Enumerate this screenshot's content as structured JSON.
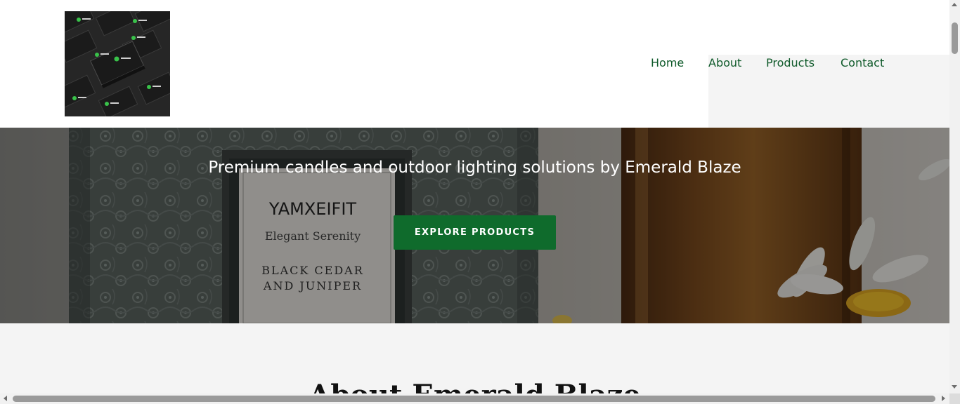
{
  "header": {
    "logo_text": "Emerald Blaze",
    "nav": [
      "Home",
      "About",
      "Products",
      "Contact"
    ]
  },
  "hero": {
    "tagline": "Premium candles and outdoor lighting solutions by Emerald Blaze",
    "cta_label": "EXPLORE PRODUCTS",
    "jar_brand": "YAMXEIFIT",
    "jar_subtitle": "Elegant Serenity",
    "jar_scent_line1": "BLACK CEDAR",
    "jar_scent_line2": "AND JUNIPER"
  },
  "about": {
    "heading": "About Emerald Blaze"
  },
  "colors": {
    "brand_green": "#0f6b2c",
    "nav_green": "#0f5a2a",
    "section_bg": "#f4f4f4"
  },
  "icons": [
    "logo-image",
    "scroll-up-arrow-icon",
    "scroll-down-arrow-icon",
    "scroll-left-arrow-icon",
    "scroll-right-arrow-icon"
  ]
}
